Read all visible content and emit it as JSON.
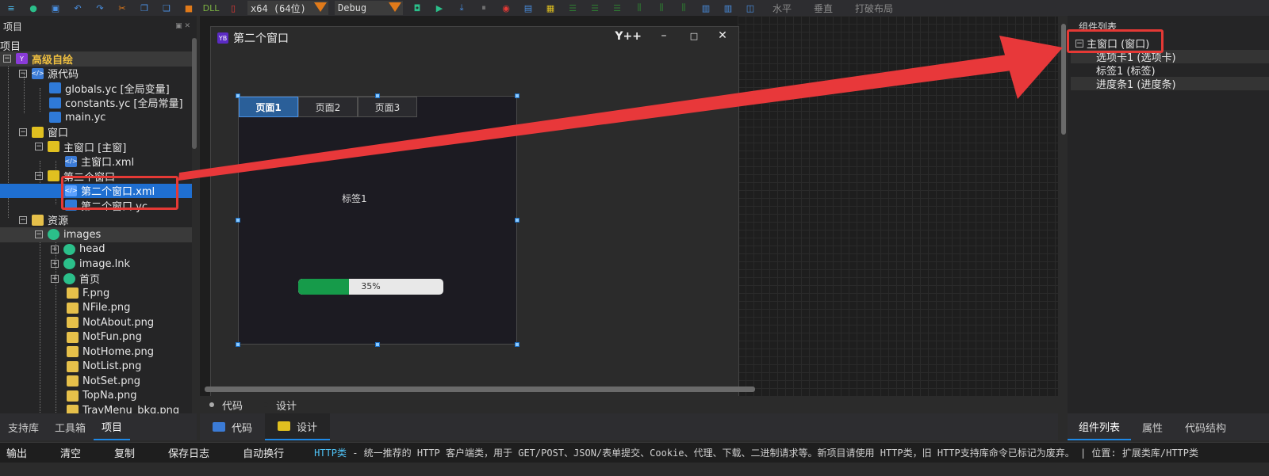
{
  "toolbar": {
    "arch_select": "x64 (64位)",
    "config_select": "Debug",
    "layout_horizontal": "水平",
    "layout_vertical": "垂直",
    "break_layout": "打破布局",
    "dll_label": "DLL"
  },
  "left_panel": {
    "title": "项目",
    "tree": [
      {
        "label": "项目"
      },
      {
        "label": "高级自绘"
      },
      {
        "label": "源代码"
      },
      {
        "label": "globals.yc [全局变量]"
      },
      {
        "label": "constants.yc [全局常量]"
      },
      {
        "label": "main.yc"
      },
      {
        "label": "窗口"
      },
      {
        "label": "主窗口 [主窗]"
      },
      {
        "label": "主窗口.xml"
      },
      {
        "label": "第二个窗口"
      },
      {
        "label": "第二个窗口.xml"
      },
      {
        "label": "第二个窗口.yc"
      },
      {
        "label": "资源"
      },
      {
        "label": "images"
      },
      {
        "label": "head"
      },
      {
        "label": "image.lnk"
      },
      {
        "label": "首页"
      },
      {
        "label": "F.png"
      },
      {
        "label": "NFile.png"
      },
      {
        "label": "NotAbout.png"
      },
      {
        "label": "NotFun.png"
      },
      {
        "label": "NotHome.png"
      },
      {
        "label": "NotList.png"
      },
      {
        "label": "NotSet.png"
      },
      {
        "label": "TopNa.png"
      },
      {
        "label": "TrayMenu_bkg.png"
      }
    ],
    "tabs": [
      "支持库",
      "工具箱",
      "项目"
    ]
  },
  "design_window": {
    "title": "第二个窗口",
    "brand": "Y++",
    "logo": "YB",
    "minimize": "–",
    "maximize": "□",
    "close": "✕",
    "tabs": [
      "页面1",
      "页面2",
      "页面3"
    ],
    "label": "标签1",
    "progress_percent": 35,
    "progress_text": "35%"
  },
  "view_radio": {
    "code": "代码",
    "design": "设计"
  },
  "bottom_tabs": {
    "code": "代码",
    "design": "设计"
  },
  "right_panel": {
    "title": "组件列表",
    "components": [
      {
        "label": "主窗口 (窗口)"
      },
      {
        "label": "选项卡1 (选项卡)"
      },
      {
        "label": "标签1 (标签)"
      },
      {
        "label": "进度条1 (进度条)"
      }
    ],
    "tabs": [
      "组件列表",
      "属性",
      "代码结构"
    ]
  },
  "output_bar": {
    "output": "输出",
    "clear": "清空",
    "copy": "复制",
    "save_log": "保存日志",
    "auto_wrap": "自动换行",
    "msg_highlight": "HTTP类",
    "msg_body": " - 统一推荐的 HTTP 客户端类，用于 GET/POST、JSON/表单提交、Cookie、代理、下载、二进制请求等。新项目请使用 HTTP类，旧 HTTP支持库命令已标记为废弃。 | 位置: 扩展类库/HTTP类"
  },
  "colors": {
    "accent": "#1f6fd1",
    "annotation": "#e53935",
    "progress": "#169b4a"
  }
}
